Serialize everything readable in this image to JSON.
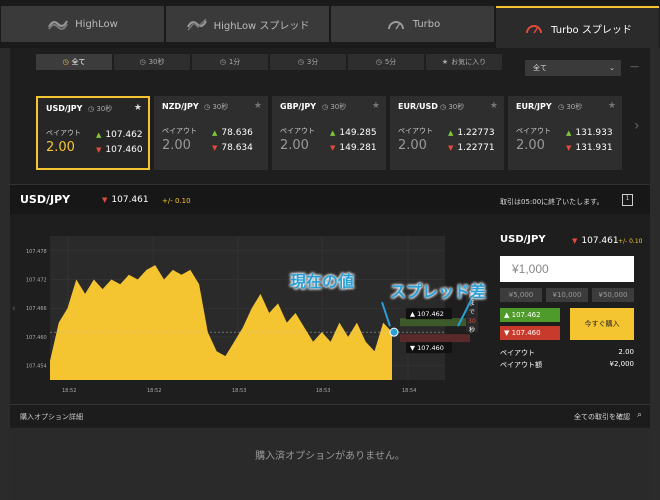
{
  "tabs": [
    {
      "label": "HighLow",
      "icon": "highlow-icon",
      "active": false
    },
    {
      "label": "HighLow スプレッド",
      "icon": "highlow-spread-icon",
      "active": false
    },
    {
      "label": "Turbo",
      "icon": "turbo-icon",
      "active": false
    },
    {
      "label": "Turbo スプレッド",
      "icon": "turbo-spread-icon",
      "active": true
    }
  ],
  "filters": [
    {
      "label": "全て",
      "icon": "clock-icon"
    },
    {
      "label": "30秒",
      "icon": "clock-icon"
    },
    {
      "label": "1分",
      "icon": "clock-icon"
    },
    {
      "label": "3分",
      "icon": "clock-icon"
    },
    {
      "label": "5分",
      "icon": "clock-icon"
    },
    {
      "label": "お気に入り",
      "icon": "star-icon"
    }
  ],
  "filter_select": "全て",
  "filter_dash": "—",
  "cards": [
    {
      "symbol": "USD/JPY",
      "time": "30秒",
      "payout_label": "ペイアウト",
      "payout": "2.00",
      "high": "107.462",
      "low": "107.460",
      "active": true
    },
    {
      "symbol": "NZD/JPY",
      "time": "30秒",
      "payout_label": "ペイアウト",
      "payout": "2.00",
      "high": "78.636",
      "low": "78.634",
      "active": false
    },
    {
      "symbol": "GBP/JPY",
      "time": "30秒",
      "payout_label": "ペイアウト",
      "payout": "2.00",
      "high": "149.285",
      "low": "149.281",
      "active": false
    },
    {
      "symbol": "EUR/USD",
      "time": "30秒",
      "payout_label": "ペイアウト",
      "payout": "2.00",
      "high": "1.22773",
      "low": "1.22771",
      "active": false
    },
    {
      "symbol": "EUR/JPY",
      "time": "30秒",
      "payout_label": "ペイアウト",
      "payout": "2.00",
      "high": "131.933",
      "low": "131.931",
      "active": false
    }
  ],
  "header": {
    "symbol": "USD/JPY",
    "rate": "107.461",
    "change": "+/- 0.10",
    "message": "取引は05:00に終了いたします。"
  },
  "chart_data": {
    "type": "area",
    "y_ticks": [
      "107.478",
      "107.472",
      "107.466",
      "107.460",
      "107.454"
    ],
    "x_ticks": [
      "18:52",
      "18:52",
      "18:53",
      "18:53",
      "18:54"
    ],
    "current_high": "107.462",
    "current_low": "107.460",
    "countdown": [
      "期",
      "ま",
      "で",
      "30",
      "秒"
    ],
    "series_y": [
      107.455,
      107.463,
      107.466,
      107.472,
      107.469,
      107.472,
      107.47,
      107.472,
      107.471,
      107.473,
      107.472,
      107.474,
      107.475,
      107.472,
      107.474,
      107.473,
      107.474,
      107.471,
      107.461,
      107.457,
      107.456,
      107.459,
      107.462,
      107.466,
      107.469,
      107.465,
      107.467,
      107.463,
      107.465,
      107.462,
      107.459,
      107.461,
      107.459,
      107.463,
      107.46,
      107.463,
      107.459,
      107.457,
      107.463,
      107.461
    ],
    "color": "#f5c531"
  },
  "annotations": {
    "current_value": "現在の値",
    "spread": "スプレッド差"
  },
  "trade": {
    "symbol": "USD/JPY",
    "rate": "107.461",
    "change": "+/- 0.10",
    "amount": "¥1,000",
    "quick": [
      "¥5,000",
      "¥10,000",
      "¥50,000"
    ],
    "high": "107.462",
    "low": "107.460",
    "buy_label": "今すぐ購入",
    "payout_label": "ペイアウト",
    "payout": "2.00",
    "payout_amount_label": "ペイアウト額",
    "payout_amount": "¥2,000"
  },
  "details": {
    "title": "購入オプション詳細",
    "link": "全ての取引を確認"
  },
  "empty_message": "購入済オプションがありません。",
  "colors": {
    "accent": "#f5c531",
    "up": "#7ec73a",
    "down": "#e04b3b",
    "annotation": "#2a9fd6"
  }
}
